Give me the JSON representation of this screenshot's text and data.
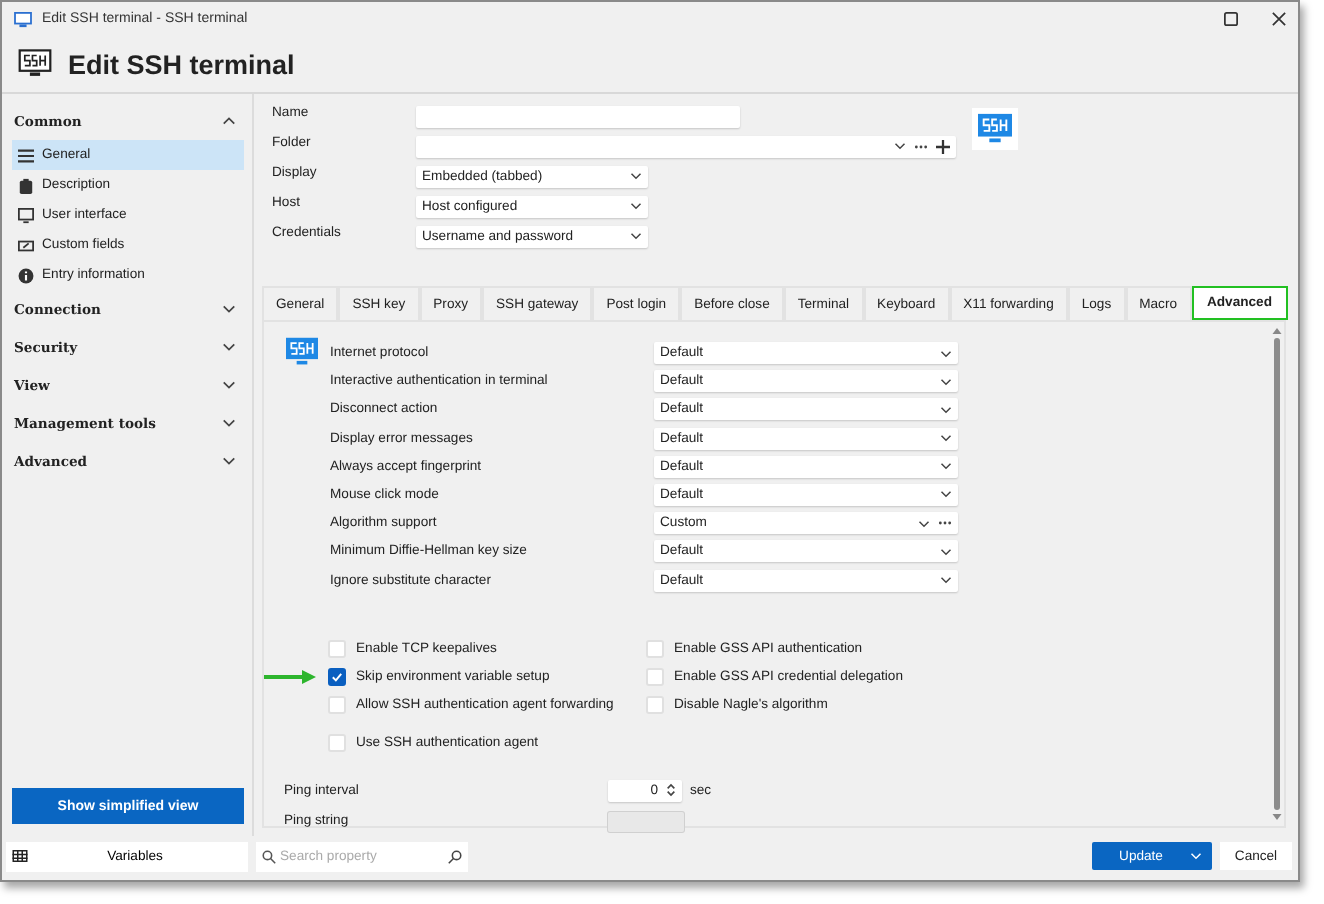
{
  "window": {
    "title": "Edit SSH terminal - SSH terminal"
  },
  "header": {
    "title": "Edit SSH terminal"
  },
  "sidebar": {
    "groups": [
      {
        "label": "Common",
        "expanded": true,
        "items": [
          {
            "label": "General",
            "selected": true
          },
          {
            "label": "Description",
            "selected": false
          },
          {
            "label": "User interface",
            "selected": false
          },
          {
            "label": "Custom fields",
            "selected": false
          },
          {
            "label": "Entry information",
            "selected": false
          }
        ]
      },
      {
        "label": "Connection",
        "expanded": false
      },
      {
        "label": "Security",
        "expanded": false
      },
      {
        "label": "View",
        "expanded": false
      },
      {
        "label": "Management tools",
        "expanded": false
      },
      {
        "label": "Advanced",
        "expanded": false
      }
    ],
    "button": "Show simplified view"
  },
  "form": [
    {
      "label": "Name",
      "kind": "text"
    },
    {
      "label": "Folder",
      "kind": "combo"
    },
    {
      "label": "Display",
      "kind": "select",
      "value": "Embedded (tabbed)"
    },
    {
      "label": "Host",
      "kind": "select",
      "value": "Host configured"
    },
    {
      "label": "Credentials",
      "kind": "select",
      "value": "Username and password"
    }
  ],
  "tabs": [
    {
      "label": "General",
      "selected": false
    },
    {
      "label": "SSH key",
      "selected": false
    },
    {
      "label": "Proxy",
      "selected": false
    },
    {
      "label": "SSH gateway",
      "selected": false
    },
    {
      "label": "Post login",
      "selected": false
    },
    {
      "label": "Before close",
      "selected": false
    },
    {
      "label": "Terminal",
      "selected": false
    },
    {
      "label": "Keyboard",
      "selected": false
    },
    {
      "label": "X11 forwarding",
      "selected": false
    },
    {
      "label": "Logs",
      "selected": false
    },
    {
      "label": "Macro",
      "selected": false
    },
    {
      "label": "Advanced",
      "selected": true
    }
  ],
  "options": [
    {
      "label": "Internet protocol",
      "kind": "select",
      "value": "Default"
    },
    {
      "label": "Interactive authentication in terminal",
      "kind": "select",
      "value": "Default"
    },
    {
      "label": "Disconnect action",
      "kind": "select",
      "value": "Default"
    },
    {
      "label": "Display error messages",
      "kind": "select",
      "value": "Default"
    },
    {
      "label": "Always accept fingerprint",
      "kind": "select",
      "value": "Default"
    },
    {
      "label": "Mouse click mode",
      "kind": "select",
      "value": "Default"
    },
    {
      "label": "Algorithm support",
      "kind": "select_more",
      "value": "Custom"
    },
    {
      "label": "Minimum Diffie-Hellman key size",
      "kind": "select",
      "value": "Default"
    },
    {
      "label": "Ignore substitute character",
      "kind": "select",
      "value": "Default"
    }
  ],
  "checkboxes_left": [
    {
      "label": "Enable TCP keepalives",
      "checked": false,
      "pointed": false
    },
    {
      "label": "Skip environment variable setup",
      "checked": true,
      "pointed": true
    },
    {
      "label": "Allow SSH authentication agent forwarding",
      "checked": false,
      "pointed": false
    },
    {
      "label": "Use SSH authentication agent",
      "checked": false,
      "pointed": false
    }
  ],
  "checkboxes_right": [
    {
      "label": "Enable GSS API authentication",
      "checked": false
    },
    {
      "label": "Enable GSS API credential delegation",
      "checked": false
    },
    {
      "label": "Disable Nagle's algorithm",
      "checked": false
    }
  ],
  "ping_interval": {
    "label": "Ping interval",
    "value": "0",
    "unit": "sec"
  },
  "ping_string": {
    "label": "Ping string",
    "disabled": true
  },
  "footer": {
    "variables": "Variables",
    "search_placeholder": "Search property",
    "update": "Update",
    "cancel": "Cancel"
  }
}
